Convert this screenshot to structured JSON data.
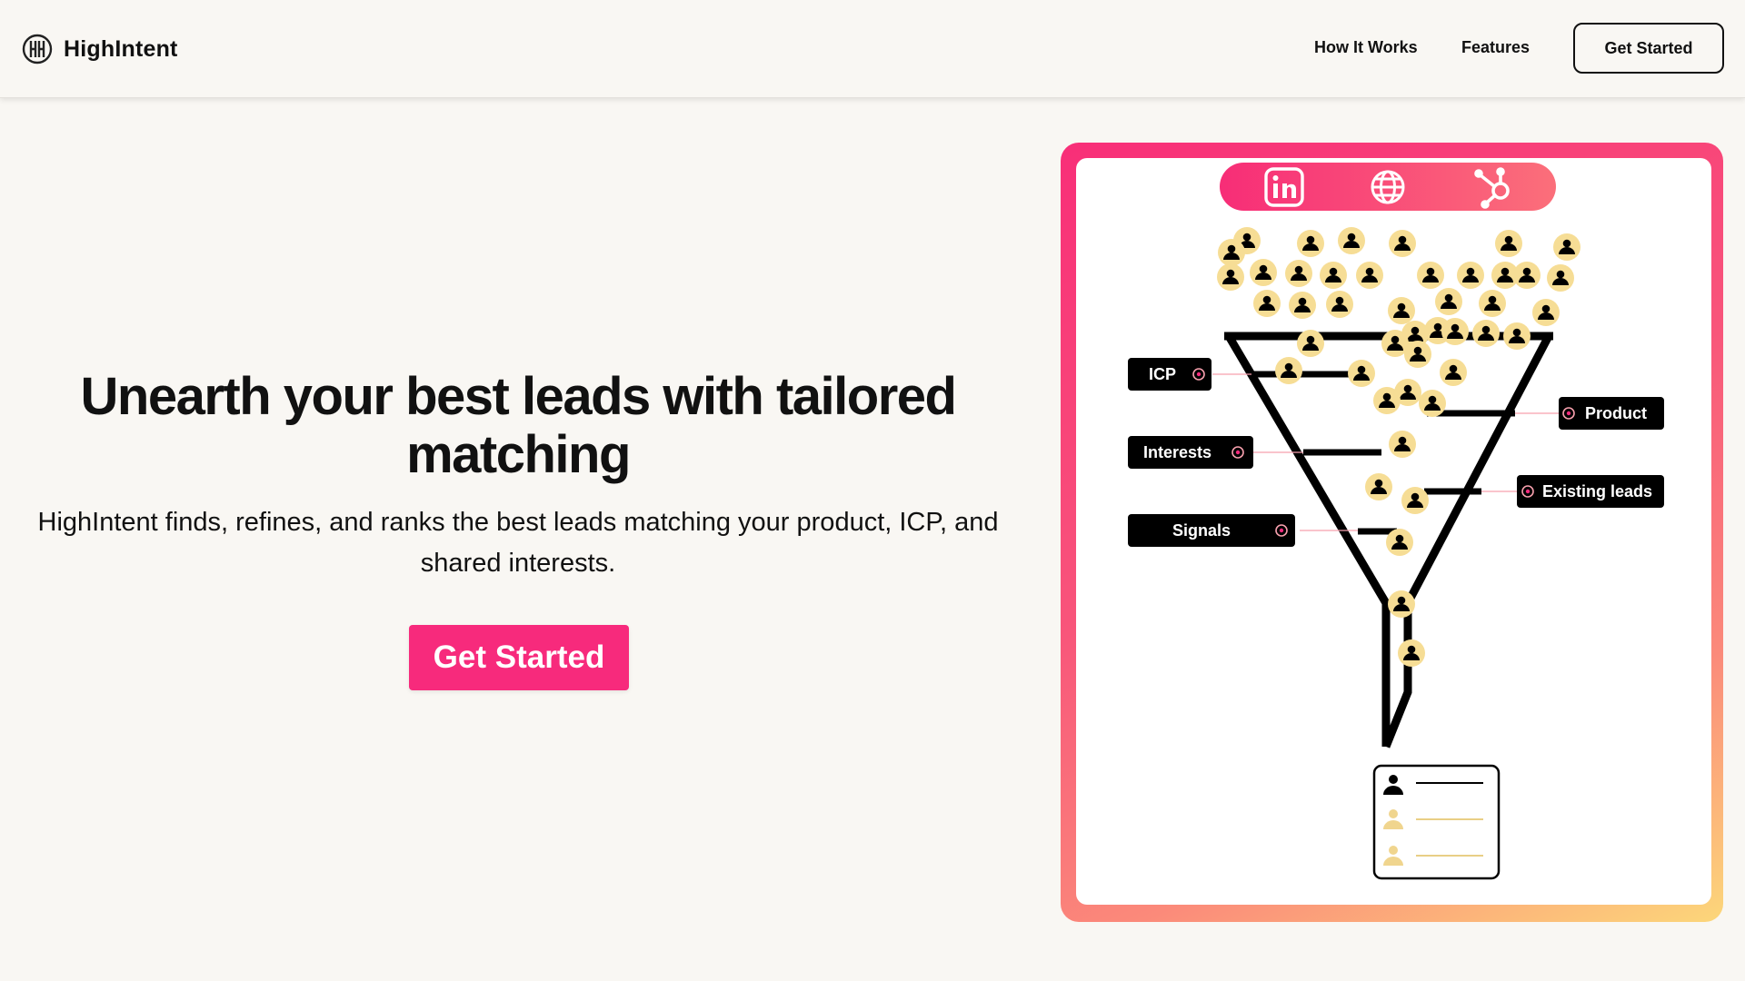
{
  "header": {
    "brand": "HighIntent",
    "nav": [
      "How It Works",
      "Features"
    ],
    "cta": "Get Started"
  },
  "hero": {
    "title": "Unearth your best leads with tailored matching",
    "subtitle": "HighIntent finds, refines, and ranks the best leads matching your product, ICP, and shared interests.",
    "cta": "Get Started"
  },
  "illustration": {
    "sources": [
      "linkedin-icon",
      "globe-icon",
      "hubspot-icon"
    ],
    "left_tags": [
      "ICP",
      "Interests",
      "Signals"
    ],
    "right_tags": [
      "Product",
      "Existing leads"
    ]
  },
  "colors": {
    "accent": "#f72a7c",
    "background": "#f9f7f3",
    "lead_fill": "#f6dd95",
    "text": "#111111"
  }
}
